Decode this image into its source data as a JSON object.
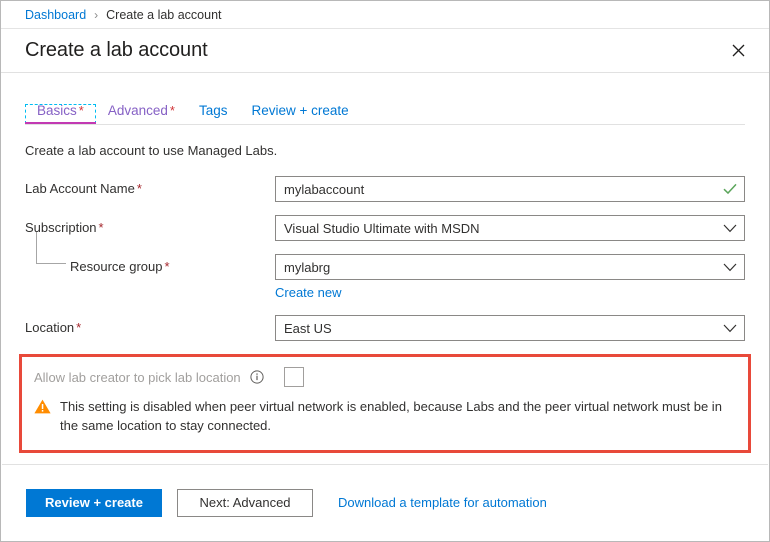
{
  "breadcrumb": {
    "root": "Dashboard",
    "separator": "›",
    "current": "Create a lab account"
  },
  "header": {
    "title": "Create a lab account",
    "close_icon": "close-icon"
  },
  "tabs": [
    {
      "label": "Basics",
      "required_marker": "*",
      "selected": true
    },
    {
      "label": "Advanced",
      "required_marker": "*",
      "selected": false
    },
    {
      "label": "Tags",
      "required_marker": "",
      "selected": false
    },
    {
      "label": "Review + create",
      "required_marker": "",
      "selected": false
    }
  ],
  "intro": "Create a lab account to use Managed Labs.",
  "fields": {
    "lab_account_name": {
      "label": "Lab Account Name",
      "required_marker": "*",
      "value": "mylabaccount",
      "placeholder": "",
      "status_icon": "checkmark-icon"
    },
    "subscription": {
      "label": "Subscription",
      "required_marker": "*",
      "value": "Visual Studio Ultimate with MSDN"
    },
    "resource_group": {
      "label": "Resource group",
      "required_marker": "*",
      "value": "mylabrg",
      "create_new_link": "Create new"
    },
    "location": {
      "label": "Location",
      "required_marker": "*",
      "value": "East US"
    }
  },
  "warning_section": {
    "toggle_label": "Allow lab creator to pick lab location",
    "info_icon": "info-icon",
    "checkbox_checked": false,
    "warning_icon": "warning-triangle-icon",
    "warning_text": "This setting is disabled when peer virtual network is enabled, because Labs and the peer virtual network must be in the same location to stay connected.",
    "highlight_color": "#e8493a"
  },
  "footer": {
    "primary_button": "Review + create",
    "secondary_button": "Next: Advanced",
    "link": "Download a template for automation"
  },
  "colors": {
    "accent": "#0078d4",
    "tab_selected": "#c239b3",
    "required": "#a4262c",
    "valid": "#5ba55b",
    "warning": "#ff8c00",
    "error_border": "#e8493a"
  }
}
